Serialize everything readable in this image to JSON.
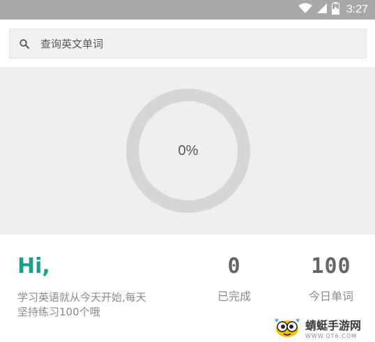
{
  "status_bar": {
    "time": "3:27",
    "icons": [
      "wifi-icon",
      "cell-signal-icon",
      "battery-charging-icon"
    ]
  },
  "search": {
    "placeholder": "查询英文单词",
    "icon": "search-icon"
  },
  "progress": {
    "value": 0,
    "label": "0%"
  },
  "greeting": {
    "title": "Hi,",
    "motto_line1": "学习英语就从今天开始,每天",
    "motto_line2": "坚持练习100个哦"
  },
  "stats": {
    "done_value": "0",
    "done_label": "已完成",
    "today_value": "100",
    "today_label": "今日单词"
  },
  "watermark": {
    "title": "蜻蜓手游网",
    "url": "WWW.QT6.COM"
  },
  "colors": {
    "accent": "#1e9f8a",
    "status_bar": "#a8a8a8",
    "ring": "#d6d6d6",
    "panel_bg": "#efefef"
  }
}
